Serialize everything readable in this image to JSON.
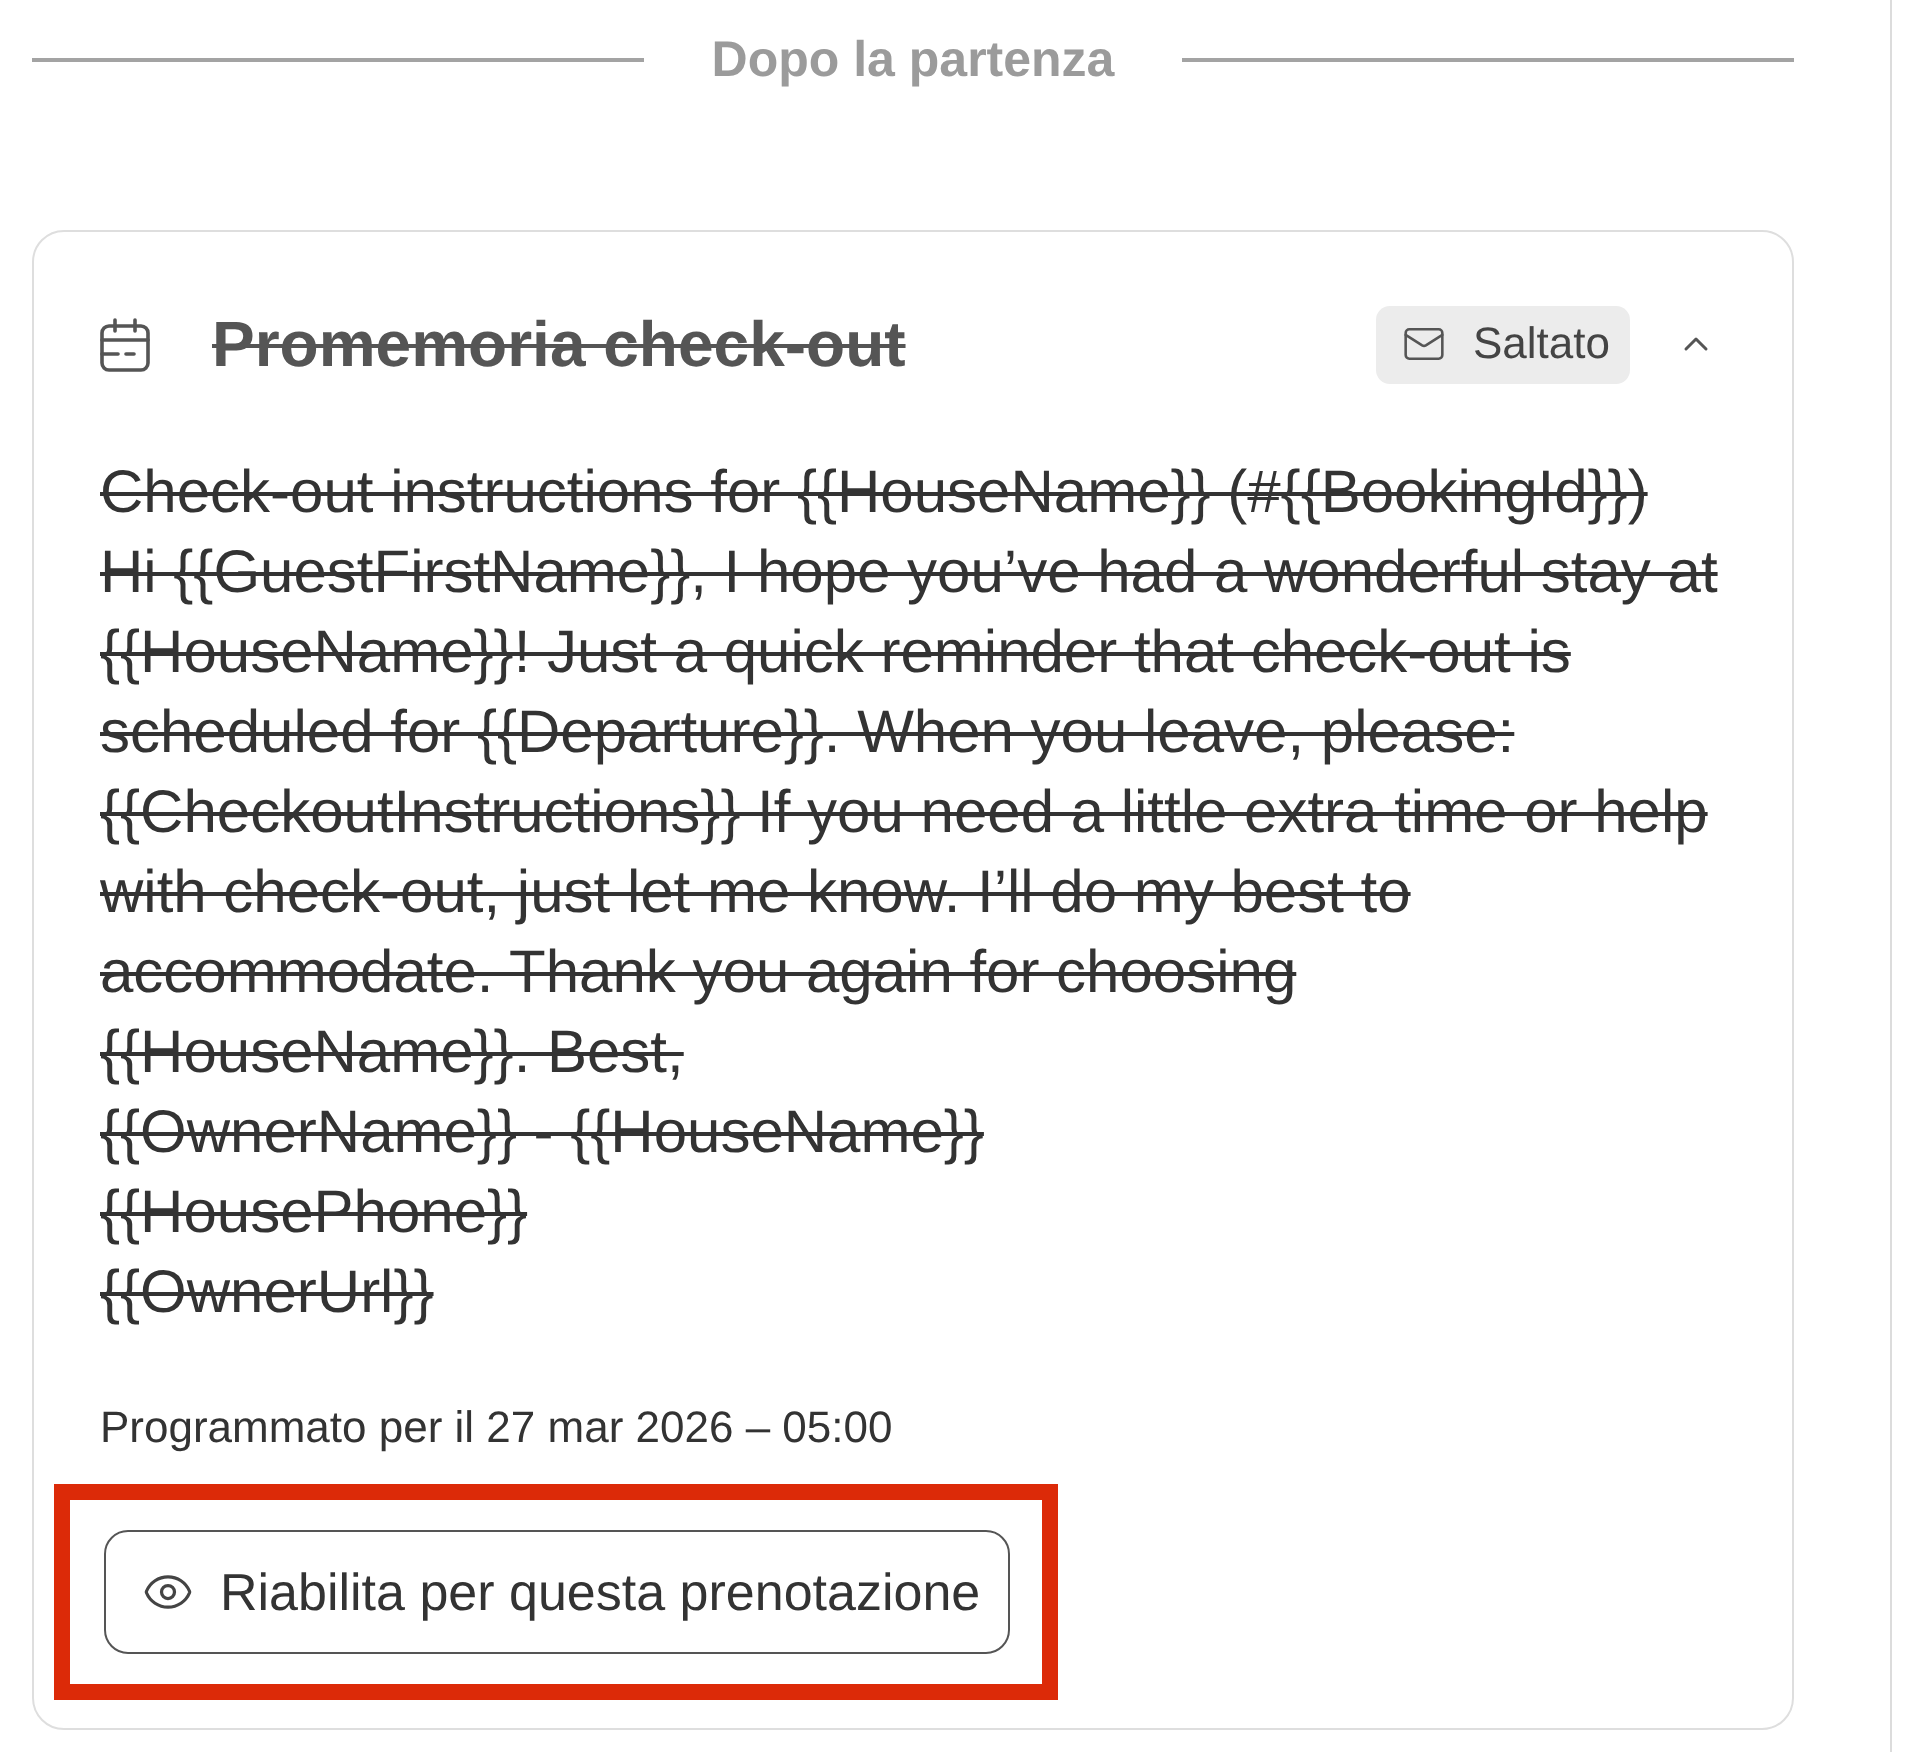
{
  "section_divider": {
    "label": "Dopo la partenza"
  },
  "reminder": {
    "title": "Promemoria check-out",
    "skipped": true,
    "expanded": true,
    "status_badge": {
      "label": "Saltato"
    },
    "message_lines": [
      "Check-out instructions for {{HouseName}} (#{{BookingId}})",
      "Hi {{GuestFirstName}}, I hope you’ve had a wonderful stay at",
      "{{HouseName}}! Just a quick reminder that check-out is",
      "scheduled for {{Departure}}. When you leave, please:",
      "{{CheckoutInstructions}} If you need a little extra time or help",
      "with check-out, just let me know. I’ll do my best to",
      "accommodate. Thank you again for choosing",
      "{{HouseName}}. Best,",
      "{{OwnerName}} - {{HouseName}}",
      "{{HousePhone}}",
      "{{OwnerUrl}}"
    ],
    "schedule": "Programmato per il 27 mar 2026 – 05:00",
    "action_button": {
      "label": "Riabilita per questa prenotazione",
      "highlighted": true
    }
  }
}
